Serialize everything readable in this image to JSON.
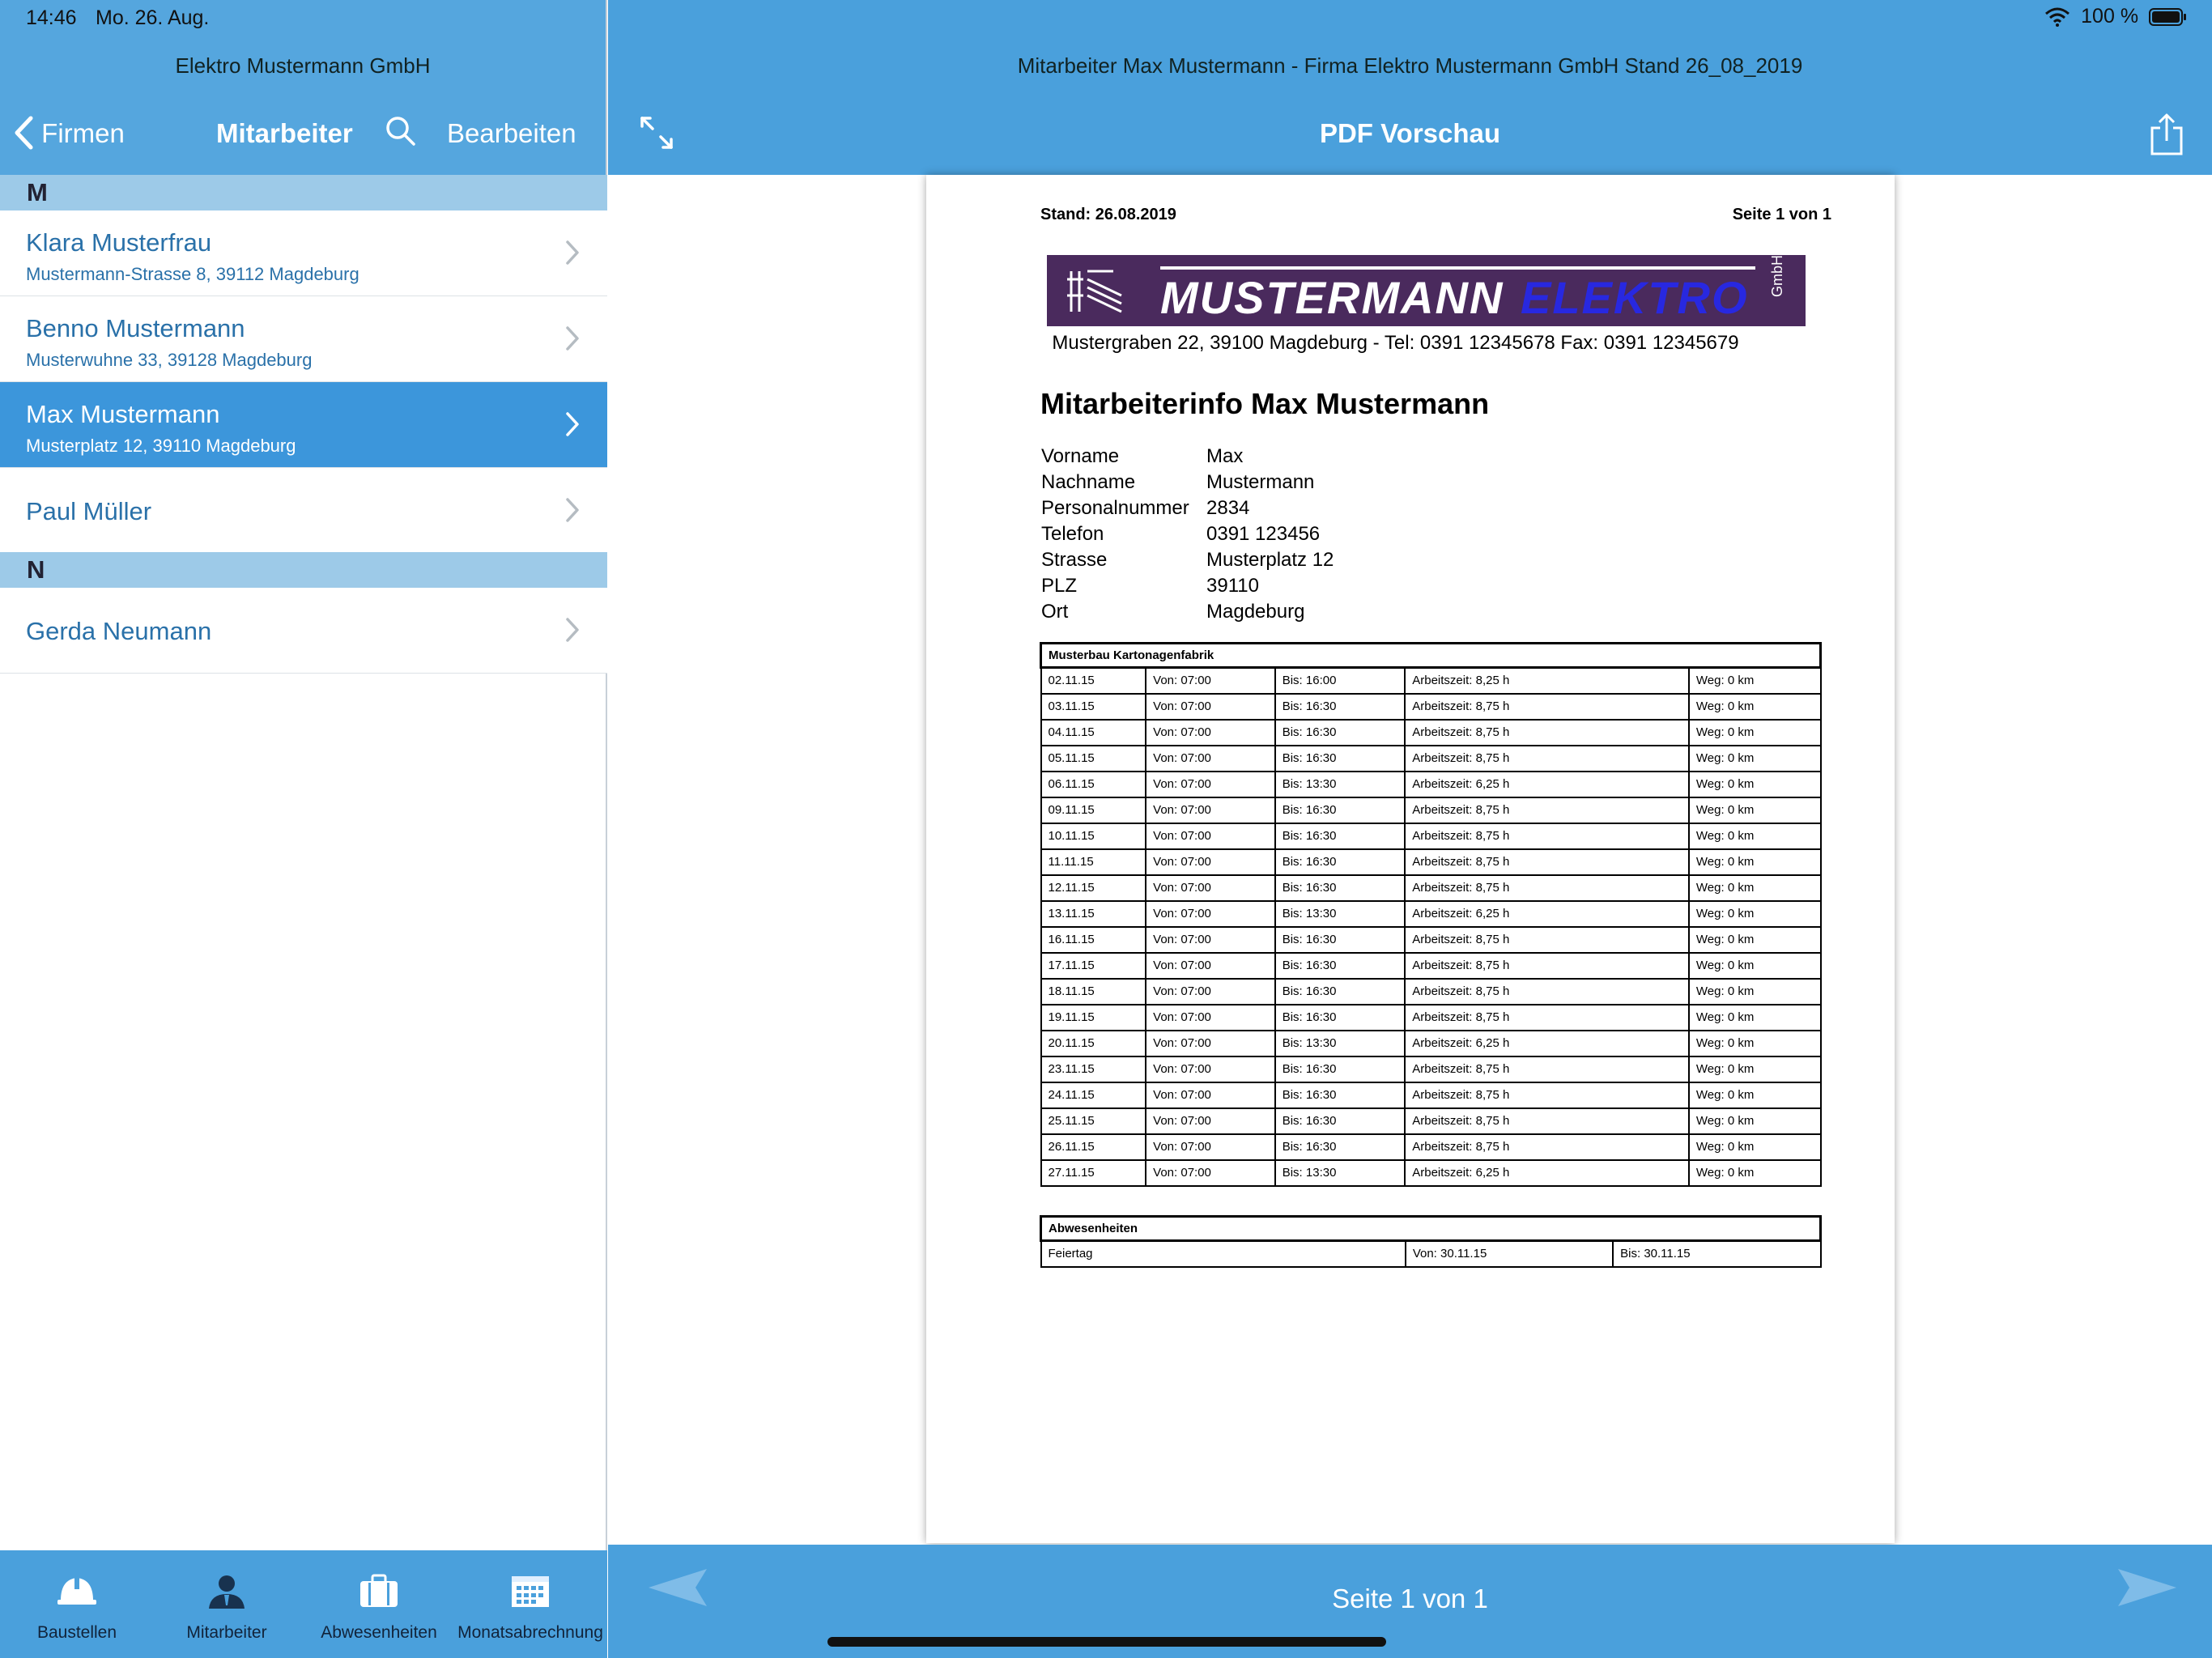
{
  "status": {
    "time": "14:46",
    "date": "Mo. 26. Aug.",
    "battery": "100 %"
  },
  "left": {
    "company": "Elektro Mustermann GmbH",
    "back_label": "Firmen",
    "title": "Mitarbeiter",
    "edit_label": "Bearbeiten",
    "sections": [
      {
        "letter": "M",
        "items": [
          {
            "name": "Klara Musterfrau",
            "address": "Mustermann-Strasse 8, 39112 Magdeburg"
          },
          {
            "name": "Benno Mustermann",
            "address": "Musterwuhne 33, 39128 Magdeburg"
          },
          {
            "name": "Max Mustermann",
            "address": "Musterplatz 12, 39110 Magdeburg"
          },
          {
            "name": "Paul Müller",
            "address": ""
          }
        ]
      },
      {
        "letter": "N",
        "items": [
          {
            "name": "Gerda Neumann",
            "address": ""
          }
        ]
      }
    ],
    "tabs": [
      {
        "label": "Baustellen",
        "icon": "helmet-icon"
      },
      {
        "label": "Mitarbeiter",
        "icon": "worker-icon"
      },
      {
        "label": "Abwesenheiten",
        "icon": "suitcase-icon"
      },
      {
        "label": "Monatsabrechnung",
        "icon": "calendar-icon"
      }
    ]
  },
  "right": {
    "window_title": "Mitarbeiter Max Mustermann - Firma Elektro Mustermann GmbH Stand 26_08_2019",
    "title": "PDF Vorschau",
    "footer_page": "Seite 1 von 1"
  },
  "pdf": {
    "stand": "Stand: 26.08.2019",
    "page": "Seite 1 von 1",
    "logo_word1": "MUSTERMANN",
    "logo_word2": "ELEKTRO",
    "logo_gmbh": "GmbH",
    "address_line": "Mustergraben 22, 39100 Magdeburg  -  Tel: 0391 12345678 Fax: 0391 12345679",
    "heading": "Mitarbeiterinfo Max Mustermann",
    "info": [
      {
        "k": "Vorname",
        "v": "Max"
      },
      {
        "k": "Nachname",
        "v": "Mustermann"
      },
      {
        "k": "Personalnummer",
        "v": "2834"
      },
      {
        "k": "Telefon",
        "v": "0391 123456"
      },
      {
        "k": "Strasse",
        "v": "Musterplatz 12"
      },
      {
        "k": "PLZ",
        "v": "39110"
      },
      {
        "k": "Ort",
        "v": "Magdeburg"
      }
    ],
    "work_title": "Musterbau Kartonagenfabrik",
    "work_rows": [
      [
        "02.11.15",
        "Von: 07:00",
        "Bis: 16:00",
        "Arbeitszeit: 8,25 h",
        "Weg: 0 km"
      ],
      [
        "03.11.15",
        "Von: 07:00",
        "Bis: 16:30",
        "Arbeitszeit: 8,75 h",
        "Weg: 0 km"
      ],
      [
        "04.11.15",
        "Von: 07:00",
        "Bis: 16:30",
        "Arbeitszeit: 8,75 h",
        "Weg: 0 km"
      ],
      [
        "05.11.15",
        "Von: 07:00",
        "Bis: 16:30",
        "Arbeitszeit: 8,75 h",
        "Weg: 0 km"
      ],
      [
        "06.11.15",
        "Von: 07:00",
        "Bis: 13:30",
        "Arbeitszeit: 6,25 h",
        "Weg: 0 km"
      ],
      [
        "09.11.15",
        "Von: 07:00",
        "Bis: 16:30",
        "Arbeitszeit: 8,75 h",
        "Weg: 0 km"
      ],
      [
        "10.11.15",
        "Von: 07:00",
        "Bis: 16:30",
        "Arbeitszeit: 8,75 h",
        "Weg: 0 km"
      ],
      [
        "11.11.15",
        "Von: 07:00",
        "Bis: 16:30",
        "Arbeitszeit: 8,75 h",
        "Weg: 0 km"
      ],
      [
        "12.11.15",
        "Von: 07:00",
        "Bis: 16:30",
        "Arbeitszeit: 8,75 h",
        "Weg: 0 km"
      ],
      [
        "13.11.15",
        "Von: 07:00",
        "Bis: 13:30",
        "Arbeitszeit: 6,25 h",
        "Weg: 0 km"
      ],
      [
        "16.11.15",
        "Von: 07:00",
        "Bis: 16:30",
        "Arbeitszeit: 8,75 h",
        "Weg: 0 km"
      ],
      [
        "17.11.15",
        "Von: 07:00",
        "Bis: 16:30",
        "Arbeitszeit: 8,75 h",
        "Weg: 0 km"
      ],
      [
        "18.11.15",
        "Von: 07:00",
        "Bis: 16:30",
        "Arbeitszeit: 8,75 h",
        "Weg: 0 km"
      ],
      [
        "19.11.15",
        "Von: 07:00",
        "Bis: 16:30",
        "Arbeitszeit: 8,75 h",
        "Weg: 0 km"
      ],
      [
        "20.11.15",
        "Von: 07:00",
        "Bis: 13:30",
        "Arbeitszeit: 6,25 h",
        "Weg: 0 km"
      ],
      [
        "23.11.15",
        "Von: 07:00",
        "Bis: 16:30",
        "Arbeitszeit: 8,75 h",
        "Weg: 0 km"
      ],
      [
        "24.11.15",
        "Von: 07:00",
        "Bis: 16:30",
        "Arbeitszeit: 8,75 h",
        "Weg: 0 km"
      ],
      [
        "25.11.15",
        "Von: 07:00",
        "Bis: 16:30",
        "Arbeitszeit: 8,75 h",
        "Weg: 0 km"
      ],
      [
        "26.11.15",
        "Von: 07:00",
        "Bis: 16:30",
        "Arbeitszeit: 8,75 h",
        "Weg: 0 km"
      ],
      [
        "27.11.15",
        "Von: 07:00",
        "Bis: 13:30",
        "Arbeitszeit: 6,25 h",
        "Weg: 0 km"
      ]
    ],
    "absence_title": "Abwesenheiten",
    "absence_rows": [
      [
        "Feiertag",
        "Von: 30.11.15",
        "Bis: 30.11.15"
      ]
    ]
  },
  "colors": {
    "accent": "#4aa0dc",
    "selected": "#3c96db",
    "section": "#9dcae8",
    "link": "#2a71a9"
  }
}
